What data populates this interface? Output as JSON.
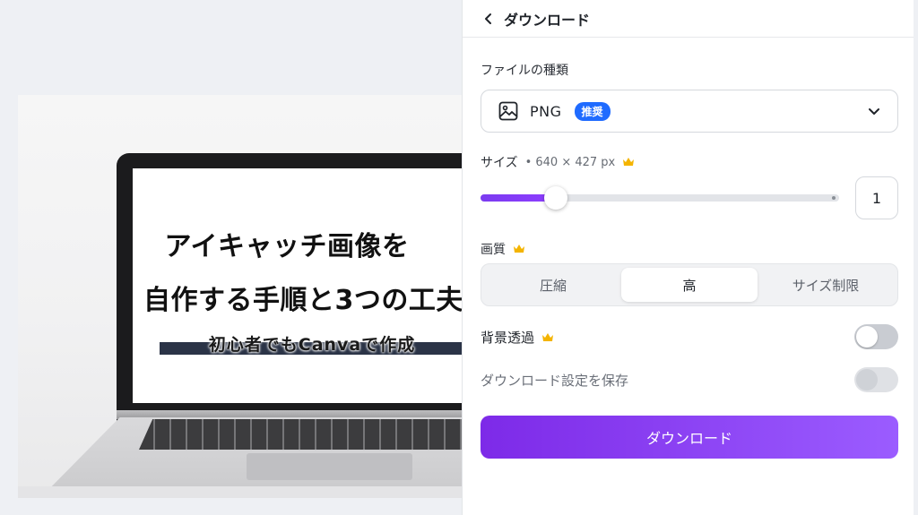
{
  "preview": {
    "headline_line1": "アイキャッチ画像を",
    "headline_line2": "自作する手順と3つの工夫",
    "subtitle": "初心者でもCanvaで作成"
  },
  "panel": {
    "title": "ダウンロード",
    "back_icon": "chevron-left-icon",
    "file_type": {
      "label": "ファイルの種類",
      "icon": "image-icon",
      "value": "PNG",
      "badge": "推奨",
      "dropdown_icon": "chevron-down-icon"
    },
    "size": {
      "label": "サイズ",
      "meta": "• 640 × 427 px",
      "premium_icon": "crown-icon",
      "slider_fraction": 0.21,
      "scale_value": "1"
    },
    "quality": {
      "label": "画質",
      "premium_icon": "crown-icon",
      "options": [
        "圧縮",
        "高",
        "サイズ制限"
      ],
      "selected": "高"
    },
    "transparent_bg": {
      "label": "背景透過",
      "premium_icon": "crown-icon",
      "enabled": false
    },
    "save_settings": {
      "label": "ダウンロード設定を保存",
      "enabled": false,
      "disabled": true
    },
    "download_button": "ダウンロード"
  },
  "colors": {
    "accent_purple": "#7d2ae8",
    "badge_blue": "#1f6bff",
    "crown_gold": "#f4b400"
  }
}
